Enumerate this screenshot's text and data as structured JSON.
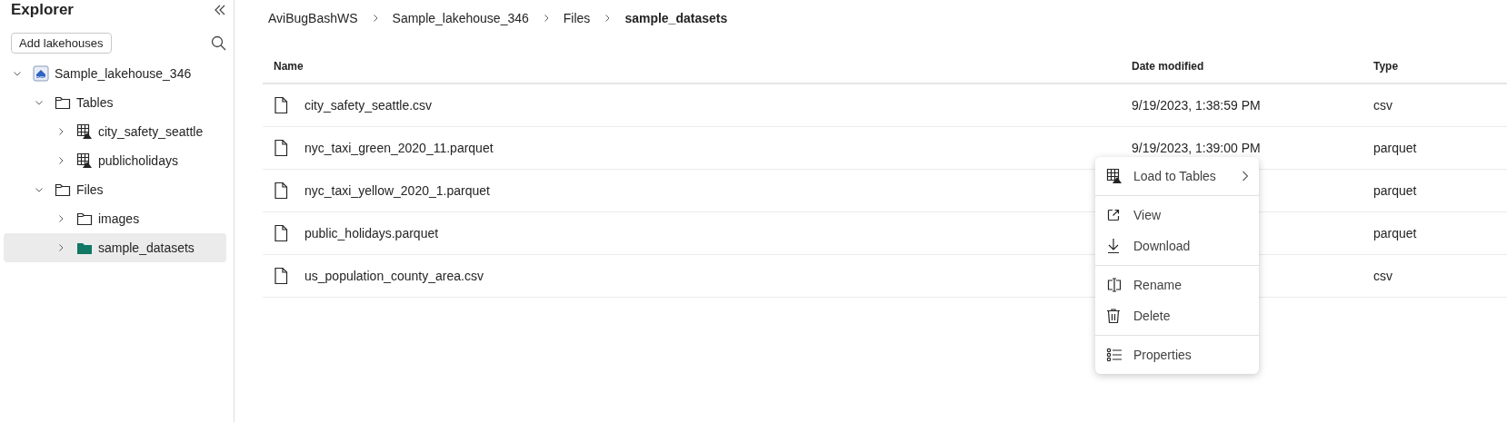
{
  "sidebar": {
    "title": "Explorer",
    "add_button": "Add lakehouses",
    "tree": [
      {
        "label": "Sample_lakehouse_346",
        "kind": "lakehouse",
        "expanded": true,
        "selected": false,
        "children": [
          {
            "label": "Tables",
            "kind": "folder",
            "expanded": true,
            "selected": false,
            "children": [
              {
                "label": "city_safety_seattle",
                "kind": "table",
                "expanded": false,
                "selected": false
              },
              {
                "label": "publicholidays",
                "kind": "table",
                "expanded": false,
                "selected": false
              }
            ]
          },
          {
            "label": "Files",
            "kind": "folder",
            "expanded": true,
            "selected": false,
            "children": [
              {
                "label": "images",
                "kind": "folder",
                "expanded": false,
                "selected": false
              },
              {
                "label": "sample_datasets",
                "kind": "folder",
                "expanded": false,
                "selected": true
              }
            ]
          }
        ]
      }
    ]
  },
  "breadcrumb": [
    {
      "label": "AviBugBashWS",
      "current": false
    },
    {
      "label": "Sample_lakehouse_346",
      "current": false
    },
    {
      "label": "Files",
      "current": false
    },
    {
      "label": "sample_datasets",
      "current": true
    }
  ],
  "table": {
    "columns": [
      "Name",
      "Date modified",
      "Type"
    ],
    "rows": [
      {
        "name": "city_safety_seattle.csv",
        "date": "9/19/2023, 1:38:59 PM",
        "type": "csv"
      },
      {
        "name": "nyc_taxi_green_2020_11.parquet",
        "date": "9/19/2023, 1:39:00 PM",
        "type": "parquet"
      },
      {
        "name": "nyc_taxi_yellow_2020_1.parquet",
        "type": "parquet"
      },
      {
        "name": "public_holidays.parquet",
        "type": "parquet"
      },
      {
        "name": "us_population_county_area.csv",
        "type": "csv"
      }
    ]
  },
  "context_menu": {
    "groups": [
      [
        {
          "label": "Load to Tables",
          "submenu": true
        }
      ],
      [
        {
          "label": "View",
          "submenu": false
        },
        {
          "label": "Download",
          "submenu": false
        }
      ],
      [
        {
          "label": "Rename",
          "submenu": false
        },
        {
          "label": "Delete",
          "submenu": false
        }
      ],
      [
        {
          "label": "Properties",
          "submenu": false
        }
      ]
    ]
  }
}
